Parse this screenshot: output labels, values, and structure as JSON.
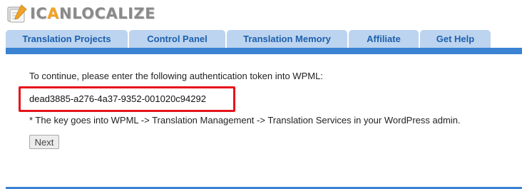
{
  "logo": {
    "prefix": "I",
    "mid1": "C",
    "o": "A",
    "rest": "NLOCALIZE",
    "icon": "pen-paper-logo-icon"
  },
  "tabs": [
    {
      "label": "Translation Projects"
    },
    {
      "label": "Control Panel"
    },
    {
      "label": "Translation Memory"
    },
    {
      "label": "Affiliate"
    },
    {
      "label": "Get Help"
    }
  ],
  "main": {
    "intro": "To continue, please enter the following authentication token into WPML:",
    "token": "dead3885-a276-4a37-9352-001020c94292",
    "note": "* The key goes into WPML -> Translation Management -> Translation Services in your WordPress admin.",
    "next_label": "Next"
  },
  "colors": {
    "tab_bg": "#bcd4ef",
    "tab_text": "#1c5fae",
    "bar": "#3b83d3",
    "highlight_border": "#e6141b",
    "logo_accent": "#f2a324"
  }
}
